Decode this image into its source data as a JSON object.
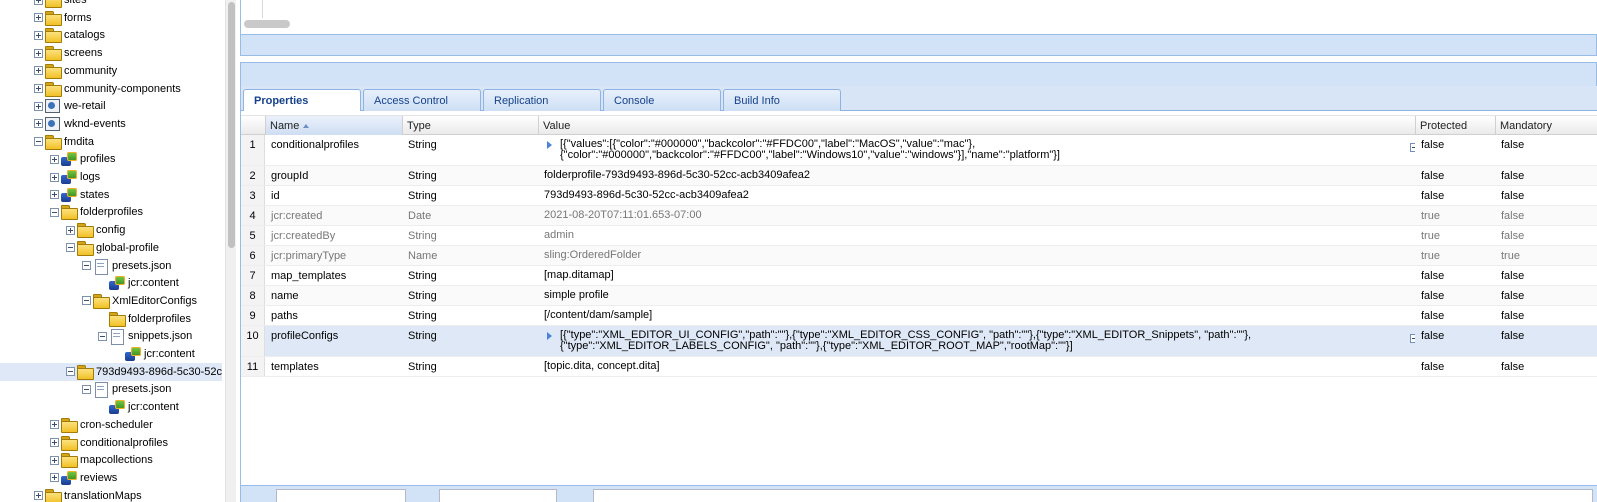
{
  "tree": {
    "nodes": [
      {
        "label": "sites",
        "toggle": "plus",
        "icon": "folder"
      },
      {
        "label": "forms",
        "toggle": "plus",
        "icon": "folder"
      },
      {
        "label": "catalogs",
        "toggle": "plus",
        "icon": "folder"
      },
      {
        "label": "screens",
        "toggle": "plus",
        "icon": "folder"
      },
      {
        "label": "community",
        "toggle": "plus",
        "icon": "folder"
      },
      {
        "label": "community-components",
        "toggle": "plus",
        "icon": "folder"
      },
      {
        "label": "we-retail",
        "toggle": "plus",
        "icon": "site"
      },
      {
        "label": "wknd-events",
        "toggle": "plus",
        "icon": "site"
      },
      {
        "label": "fmdita",
        "toggle": "minus",
        "icon": "folder"
      },
      {
        "label": "profiles",
        "toggle": "plus",
        "icon": "node"
      },
      {
        "label": "logs",
        "toggle": "plus",
        "icon": "node"
      },
      {
        "label": "states",
        "toggle": "plus",
        "icon": "node"
      },
      {
        "label": "folderprofiles",
        "toggle": "minus",
        "icon": "folder"
      },
      {
        "label": "config",
        "toggle": "plus",
        "icon": "folder"
      },
      {
        "label": "global-profile",
        "toggle": "minus",
        "icon": "folder"
      },
      {
        "label": "presets.json",
        "toggle": "minus",
        "icon": "file"
      },
      {
        "label": "jcr:content",
        "toggle": "none",
        "icon": "node"
      },
      {
        "label": "XmlEditorConfigs",
        "toggle": "minus",
        "icon": "folder"
      },
      {
        "label": "folderprofiles",
        "toggle": "none",
        "icon": "folder"
      },
      {
        "label": "snippets.json",
        "toggle": "minus",
        "icon": "file"
      },
      {
        "label": "jcr:content",
        "toggle": "none",
        "icon": "node"
      },
      {
        "label": "793d9493-896d-5c30-52c",
        "toggle": "minus",
        "icon": "folder"
      },
      {
        "label": "presets.json",
        "toggle": "minus",
        "icon": "file"
      },
      {
        "label": "jcr:content",
        "toggle": "none",
        "icon": "node"
      },
      {
        "label": "cron-scheduler",
        "toggle": "plus",
        "icon": "folder"
      },
      {
        "label": "conditionalprofiles",
        "toggle": "plus",
        "icon": "folder"
      },
      {
        "label": "mapcollections",
        "toggle": "plus",
        "icon": "folder"
      },
      {
        "label": "reviews",
        "toggle": "plus",
        "icon": "node"
      },
      {
        "label": "translationMaps",
        "toggle": "plus",
        "icon": "folder"
      }
    ]
  },
  "tabs": [
    "Properties",
    "Access Control",
    "Replication",
    "Console",
    "Build Info"
  ],
  "active_tab": "Properties",
  "grid": {
    "columns": [
      "Name",
      "Type",
      "Value",
      "Protected",
      "Mandatory"
    ],
    "sorted_column": "Name",
    "rows": [
      {
        "n": "1",
        "name": "conditionalprofiles",
        "type": "String",
        "value": [
          "[{\"values\":[{\"color\":\"#000000\",\"backcolor\":\"#FFDC00\",\"label\":\"MacOS\",\"value\":\"mac\"},",
          "{\"color\":\"#000000\",\"backcolor\":\"#FFDC00\",\"label\":\"Windows10\",\"value\":\"windows\"}],\"name\":\"platform\"}]"
        ],
        "protected": "false",
        "mandatory": "false",
        "expandable": true
      },
      {
        "n": "2",
        "name": "groupId",
        "type": "String",
        "value": [
          "folderprofile-793d9493-896d-5c30-52cc-acb3409afea2"
        ],
        "protected": "false",
        "mandatory": "false"
      },
      {
        "n": "3",
        "name": "id",
        "type": "String",
        "value": [
          "793d9493-896d-5c30-52cc-acb3409afea2"
        ],
        "protected": "false",
        "mandatory": "false"
      },
      {
        "n": "4",
        "name": "jcr:created",
        "type": "Date",
        "value": [
          "2021-08-20T07:11:01.653-07:00"
        ],
        "protected": "true",
        "mandatory": "false",
        "dim": true
      },
      {
        "n": "5",
        "name": "jcr:createdBy",
        "type": "String",
        "value": [
          "admin"
        ],
        "protected": "true",
        "mandatory": "false",
        "dim": true
      },
      {
        "n": "6",
        "name": "jcr:primaryType",
        "type": "Name",
        "value": [
          "sling:OrderedFolder"
        ],
        "protected": "true",
        "mandatory": "true",
        "dim": true
      },
      {
        "n": "7",
        "name": "map_templates",
        "type": "String",
        "value": [
          "[map.ditamap]"
        ],
        "protected": "false",
        "mandatory": "false"
      },
      {
        "n": "8",
        "name": "name",
        "type": "String",
        "value": [
          "simple profile"
        ],
        "protected": "false",
        "mandatory": "false"
      },
      {
        "n": "9",
        "name": "paths",
        "type": "String",
        "value": [
          "[/content/dam/sample]"
        ],
        "protected": "false",
        "mandatory": "false"
      },
      {
        "n": "10",
        "name": "profileConfigs",
        "type": "String",
        "value": [
          "[{\"type\":\"XML_EDITOR_UI_CONFIG\",\"path\":\"\"},{\"type\":\"XML_EDITOR_CSS_CONFIG\", \"path\":\"\"},{\"type\":\"XML_EDITOR_Snippets\", \"path\":\"\"},",
          "{\"type\":\"XML_EDITOR_LABELS_CONFIG\", \"path\":\"\"},{\"type\":\"XML_EDITOR_ROOT_MAP\",\"rootMap\":\"\"}]"
        ],
        "protected": "false",
        "mandatory": "false",
        "expandable": true,
        "highlight": true
      },
      {
        "n": "11",
        "name": "templates",
        "type": "String",
        "value": [
          "[topic.dita, concept.dita]"
        ],
        "protected": "false",
        "mandatory": "false"
      }
    ]
  }
}
